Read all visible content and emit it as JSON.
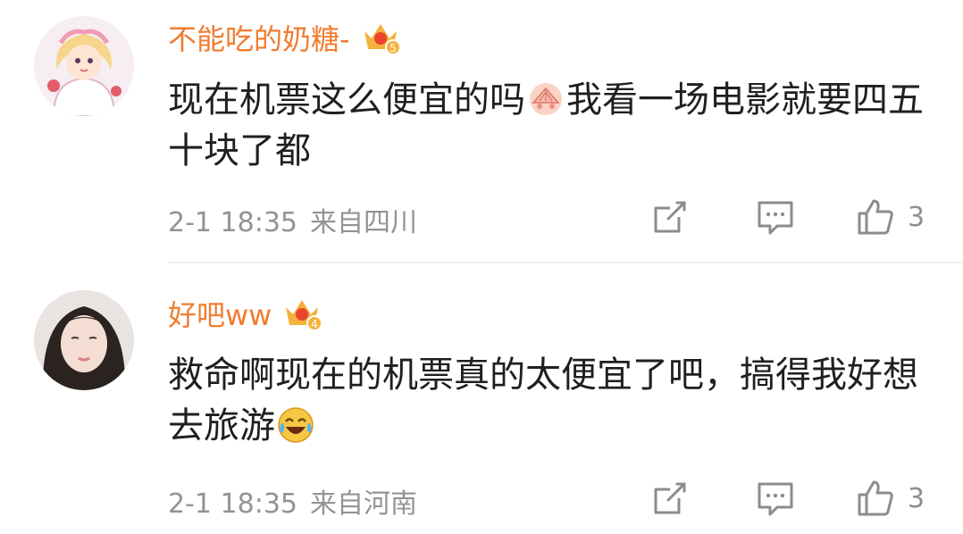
{
  "comments": [
    {
      "username": "不能吃的奶糖-",
      "vip_level": "5",
      "text_before_emoji": "现在机票这么便宜的吗",
      "emoji": "shy-fan-emoji",
      "text_after_emoji": "我看一场电影就要四五十块了都",
      "time": "2-1 18:35",
      "location": "来自四川",
      "likes": "3"
    },
    {
      "username": "好吧ww",
      "vip_level": "4",
      "text_before_emoji": "救命啊现在的机票真的太便宜了吧，搞得我好想去旅游",
      "emoji": "laugh-cry-emoji",
      "text_after_emoji": "",
      "time": "2-1 18:35",
      "location": "来自河南",
      "likes": "3"
    }
  ],
  "colors": {
    "username": "#f07c30",
    "meta": "#939393",
    "icon": "#8c8c8c",
    "vip_crown": "#f5b13d",
    "vip_gem": "#e8452c"
  }
}
